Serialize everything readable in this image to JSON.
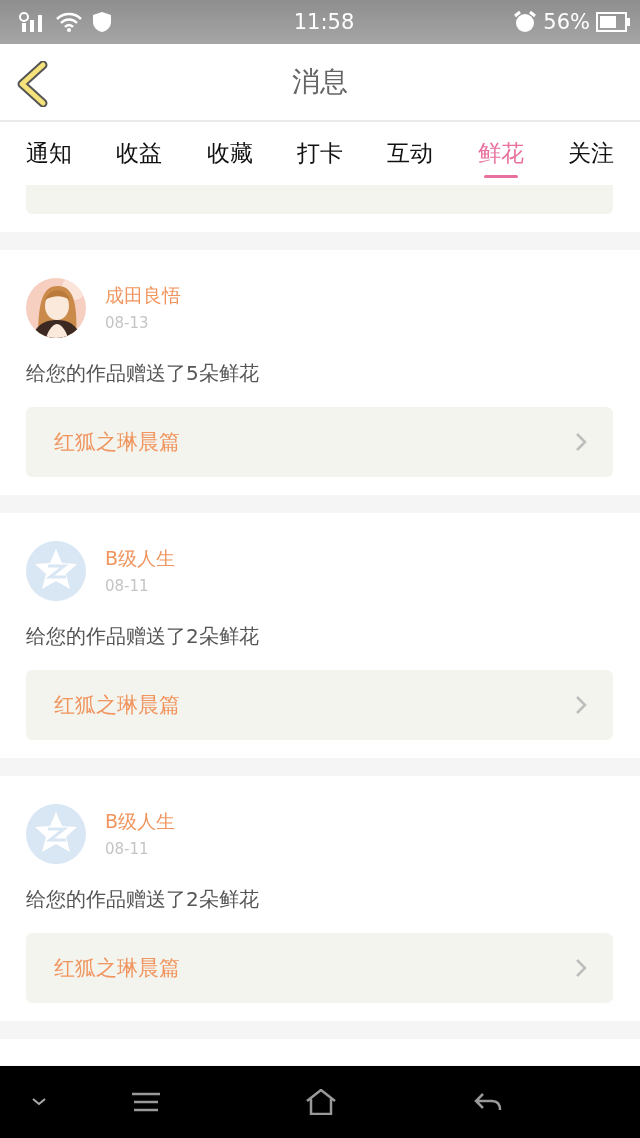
{
  "status_bar": {
    "time": "11:58",
    "battery": "56%"
  },
  "header": {
    "title": "消息"
  },
  "tabs": [
    {
      "label": "通知",
      "selected": false
    },
    {
      "label": "收益",
      "selected": false
    },
    {
      "label": "收藏",
      "selected": false
    },
    {
      "label": "打卡",
      "selected": false
    },
    {
      "label": "互动",
      "selected": false
    },
    {
      "label": "鲜花",
      "selected": true
    },
    {
      "label": "关注",
      "selected": false
    }
  ],
  "messages": [
    {
      "name": "成田良悟",
      "date": "08-13",
      "text": "给您的作品赠送了5朵鲜花",
      "work_title": "红狐之琳晨篇"
    },
    {
      "avatar": {
        "kind": "default"
      },
      "name": "B级人生",
      "date": "08-11",
      "text": "给您的作品赠送了2朵鲜花",
      "work_title": "红狐之琳晨篇"
    },
    {
      "avatar": {
        "kind": "default"
      },
      "name": "B级人生",
      "date": "08-11",
      "text": "给您的作品赠送了2朵鲜花",
      "work_title": "红狐之琳晨篇"
    }
  ]
}
